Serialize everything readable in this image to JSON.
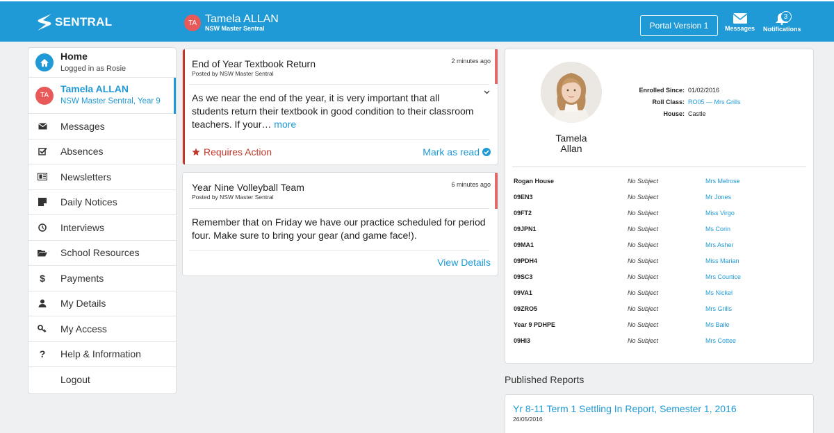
{
  "header": {
    "logo_text": "SENTRAL",
    "student_initials": "TA",
    "student_name": "Tamela ALLAN",
    "school": "NSW Master Sentral",
    "portal_button": "Portal Version 1",
    "messages_label": "Messages",
    "notifications_label": "Notifications",
    "notifications_count": "3"
  },
  "sidebar": {
    "home_title": "Home",
    "home_sub": "Logged in as Rosie",
    "student_initials": "TA",
    "student_name": "Tamela ALLAN",
    "student_sub": "NSW Master Sentral, Year 9",
    "items": [
      {
        "label": "Messages",
        "icon": "envelope-icon"
      },
      {
        "label": "Absences",
        "icon": "checkbox-icon"
      },
      {
        "label": "Newsletters",
        "icon": "newspaper-icon"
      },
      {
        "label": "Daily Notices",
        "icon": "sticky-note-icon"
      },
      {
        "label": "Interviews",
        "icon": "clock-icon"
      },
      {
        "label": "School Resources",
        "icon": "folder-open-icon"
      },
      {
        "label": "Payments",
        "icon": "dollar-icon"
      },
      {
        "label": "My Details",
        "icon": "user-icon"
      },
      {
        "label": "My Access",
        "icon": "key-icon"
      },
      {
        "label": "Help & Information",
        "icon": "question-icon"
      },
      {
        "label": "Logout",
        "icon": ""
      }
    ]
  },
  "notices": [
    {
      "title": "End of Year Textbook Return",
      "posted_by": "Posted by NSW Master Sentral",
      "time": "2 minutes ago",
      "body": "As we near the end of the year, it is very important that all students return their textbook in good condition to their classroom teachers. If your…",
      "more": "more",
      "requires_action": "Requires Action",
      "mark_read": "Mark as read"
    },
    {
      "title": "Year Nine Volleyball Team",
      "posted_by": "Posted by NSW Master Sentral",
      "time": "6 minutes ago",
      "body": "Remember that on Friday we have our practice scheduled for period four. Make sure to bring your gear (and game face!).",
      "view_details": "View Details"
    }
  ],
  "profile": {
    "first_name": "Tamela",
    "last_name": "Allan",
    "enrolled_label": "Enrolled Since:",
    "enrolled_value": "01/02/2016",
    "rollclass_label": "Roll Class:",
    "rollclass_value": "RO05 — Mrs Grills",
    "house_label": "House:",
    "house_value": "Castle",
    "classes": [
      {
        "name": "Rogan House",
        "subject": "No Subject",
        "teacher": "Mrs Melrose"
      },
      {
        "name": "09EN3",
        "subject": "No Subject",
        "teacher": "Mr Jones"
      },
      {
        "name": "09FT2",
        "subject": "No Subject",
        "teacher": "Miss Virgo"
      },
      {
        "name": "09JPN1",
        "subject": "No Subject",
        "teacher": "Ms Corin"
      },
      {
        "name": "09MA1",
        "subject": "No Subject",
        "teacher": "Mrs Asher"
      },
      {
        "name": "09PDH4",
        "subject": "No Subject",
        "teacher": "Miss Marian"
      },
      {
        "name": "09SC3",
        "subject": "No Subject",
        "teacher": "Mrs Courtice"
      },
      {
        "name": "09VA1",
        "subject": "No Subject",
        "teacher": "Ms Nickel"
      },
      {
        "name": "09ZRO5",
        "subject": "No Subject",
        "teacher": "Mrs Grills"
      },
      {
        "name": "Year 9 PDHPE",
        "subject": "No Subject",
        "teacher": "Ms Baile"
      },
      {
        "name": "09HI3",
        "subject": "No Subject",
        "teacher": "Mrs Cottee"
      }
    ]
  },
  "reports": {
    "heading": "Published Reports",
    "items": [
      {
        "title": "Yr 8-11 Term 1 Settling In Report, Semester 1, 2016",
        "date": "26/05/2016"
      }
    ]
  },
  "colors": {
    "brand": "#1f9ad6",
    "action": "#c0392b",
    "avatar": "#e85a5a"
  }
}
